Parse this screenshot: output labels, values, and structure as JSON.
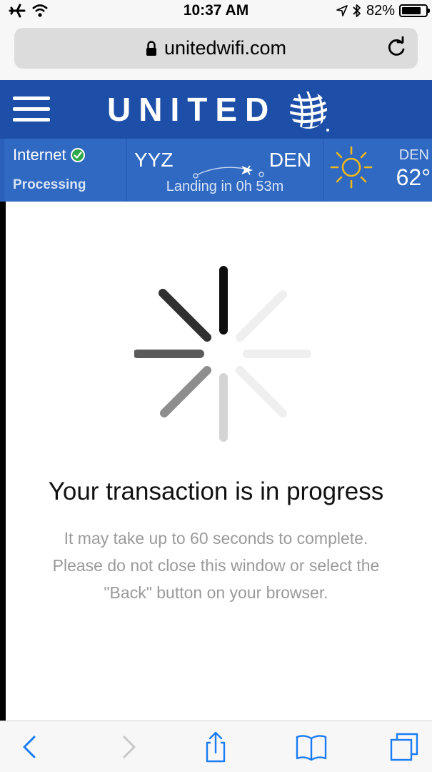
{
  "status_bar": {
    "time": "10:37 AM",
    "battery": "82%",
    "battery_level": 0.82,
    "icons": [
      "airplane-icon",
      "wifi-icon",
      "location-arrow-icon",
      "bluetooth-icon",
      "battery-icon"
    ]
  },
  "browser": {
    "url": "unitedwifi.com",
    "lock_icon": "lock-icon",
    "reload_icon": "reload-icon"
  },
  "header": {
    "logo_text": "UNITED",
    "menu_icon": "hamburger-menu-icon",
    "globe_icon": "united-globe-icon",
    "brand_color": "#1e4fa8"
  },
  "info_bar": {
    "internet_label": "Internet",
    "internet_status": "Processing",
    "origin": "YYZ",
    "destination": "DEN",
    "landing": "Landing in 0h 53m",
    "weather_city": "DEN",
    "weather_temp": "62°",
    "weather_icon": "sun-icon"
  },
  "main": {
    "headline": "Your transaction is in progress",
    "line1": "It may take up to 60 seconds to complete.",
    "line2": "Please do not close this window or select the",
    "line3": "\"Back\" button on your browser."
  },
  "toolbar": {
    "icons": [
      "back-icon",
      "forward-icon",
      "share-icon",
      "bookmarks-icon",
      "tabs-icon"
    ],
    "accent": "#1a7cf5"
  }
}
